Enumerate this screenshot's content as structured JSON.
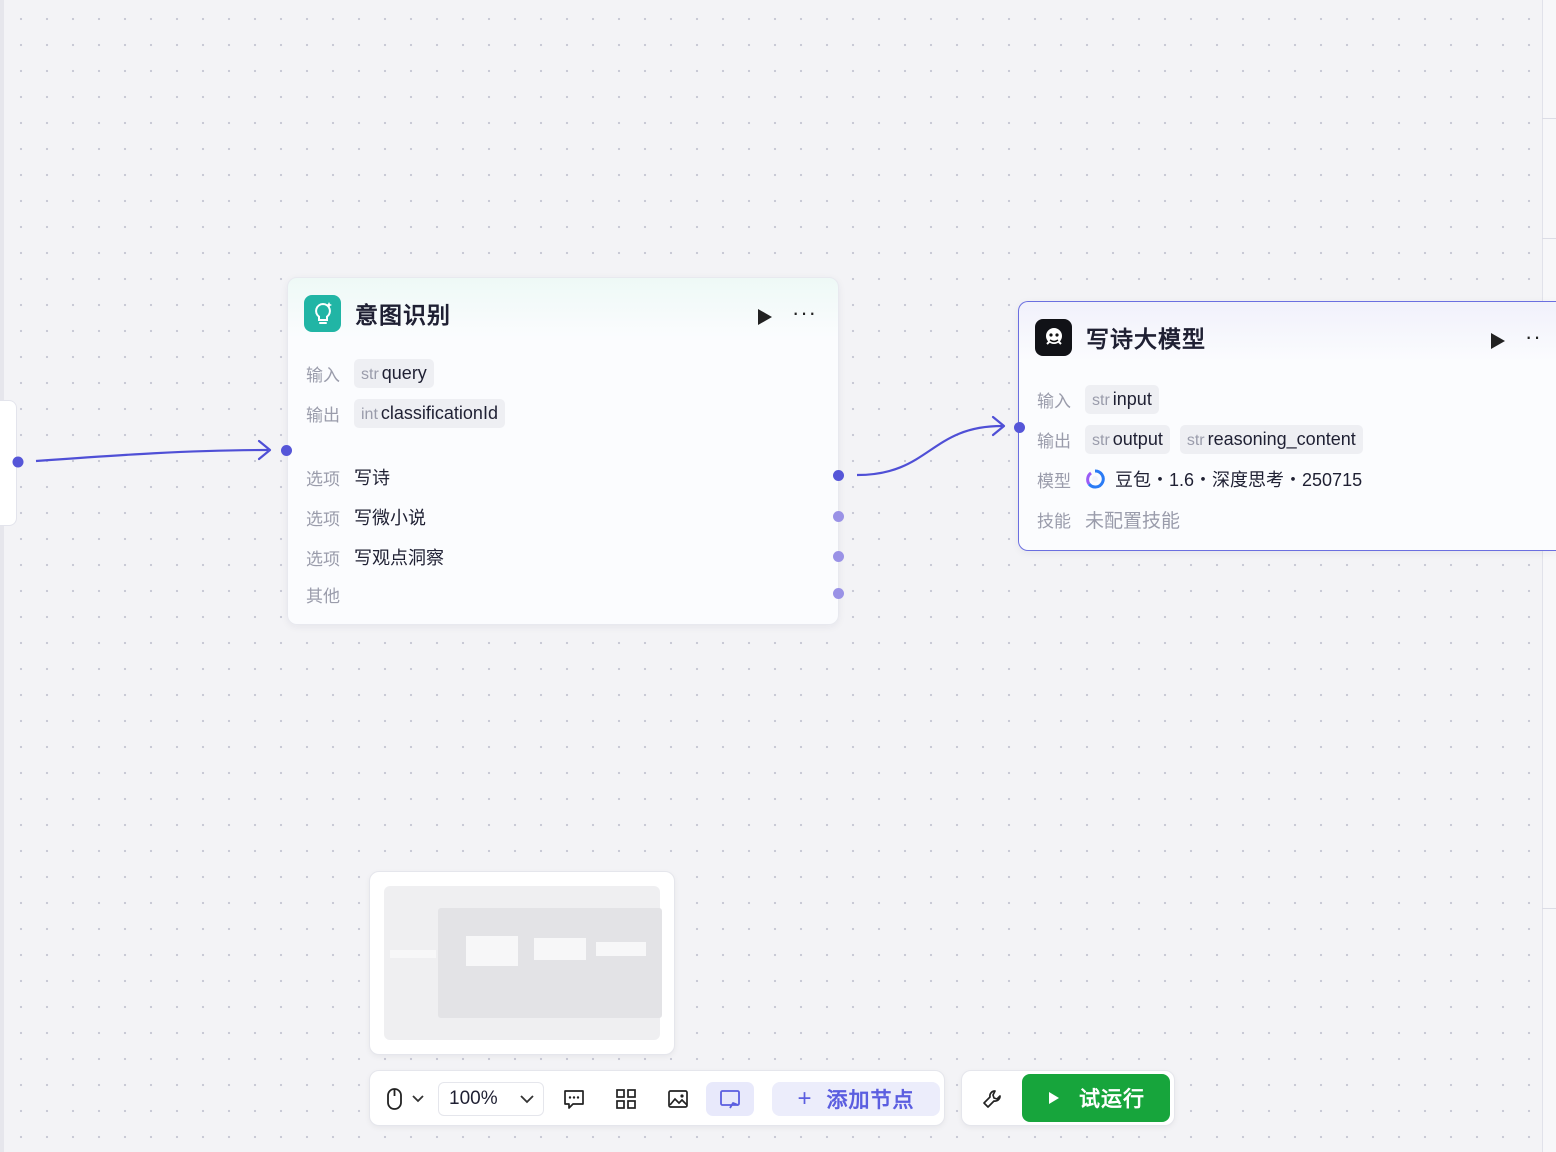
{
  "node_intent": {
    "title": "意图识别",
    "input_label": "输入",
    "input_type": "str",
    "input_name": "query",
    "output_label": "输出",
    "output_type": "int",
    "output_name": "classificationId",
    "options": [
      {
        "label": "选项",
        "value": "写诗"
      },
      {
        "label": "选项",
        "value": "写微小说"
      },
      {
        "label": "选项",
        "value": "写观点洞察"
      }
    ],
    "other_label": "其他"
  },
  "node_llm": {
    "title": "写诗大模型",
    "input_label": "输入",
    "input_type": "str",
    "input_name": "input",
    "output_label": "输出",
    "outputs": [
      {
        "type": "str",
        "name": "output"
      },
      {
        "type": "str",
        "name": "reasoning_content"
      }
    ],
    "model_label": "模型",
    "model_value": "豆包・1.6・深度思考・250715",
    "skill_label": "技能",
    "skill_value": "未配置技能"
  },
  "toolbar": {
    "zoom": "100%",
    "add_node_label": "添加节点",
    "trial_run_label": "试运行"
  },
  "colors": {
    "accent": "#5b5ee0",
    "edge": "#4f4fd6",
    "intent_icon": "#21b5a5",
    "run_button": "#17a53c"
  }
}
